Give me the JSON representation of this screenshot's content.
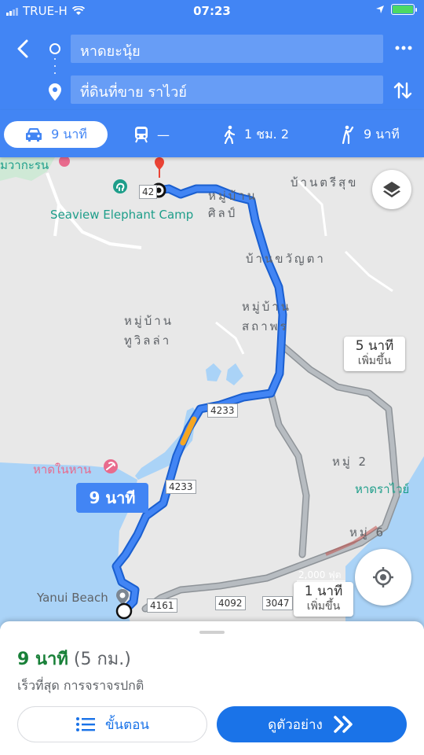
{
  "status_bar": {
    "carrier": "TRUE-H",
    "time": "07:23",
    "battery_level": 1.0
  },
  "header": {
    "origin": "หาดยะนุ้ย",
    "destination": "ที่ดินที่ขาย ราไวย์",
    "icons": [
      "back-arrow-icon",
      "origin-circle-icon",
      "destination-pin-icon",
      "more-icon",
      "swap-icon"
    ]
  },
  "modes": [
    {
      "name": "car",
      "label": "9 นาที",
      "active": true
    },
    {
      "name": "transit",
      "label": "—"
    },
    {
      "name": "walk",
      "label": "1 ชม. 2"
    },
    {
      "name": "ride",
      "label": "9 นาที"
    }
  ],
  "map": {
    "places": {
      "cut_label": "มวากะรน",
      "elephant_camp": "Seaview Elephant Camp",
      "village_silp": "หมู่บ้าน\nศิลป์",
      "ban_tri_suk": "บ้านตรีสุข",
      "ban_khwanta": "บ้านขวัญตา",
      "village_sathaporn": "หมู่บ้าน\nสถาพร",
      "village_tuvila": "หมู่บ้าน\nทูวิลล่า",
      "moo2": "หมู่ 2",
      "had_nai_han": "หาดในหาน",
      "had_rawai": "หาดราไวย์",
      "moo6": "หมู่ 6",
      "yanui_beach": "Yanui Beach",
      "scale": "2,000 ฟุต"
    },
    "road_badges": [
      "42",
      "4233",
      "4233",
      "4161",
      "4092",
      "3047"
    ],
    "route_label": "9 นาที",
    "alt_callouts": [
      {
        "time": "5 นาที",
        "note": "เพิ่มขึ้น"
      },
      {
        "time": "1 นาที",
        "note": "เพิ่มขึ้น"
      }
    ],
    "colors": {
      "route": "#4285f4",
      "route_outline": "#1a5fd0",
      "traffic": "#f5a623",
      "alt_route": "#9aa0a6",
      "water": "#aad3f7"
    }
  },
  "sheet": {
    "duration": "9 นาที",
    "distance": "(5 กม.)",
    "subtitle": "เร็วที่สุด การจราจรปกติ",
    "steps_label": "ขั้นตอน",
    "preview_label": "ดูตัวอย่าง"
  }
}
